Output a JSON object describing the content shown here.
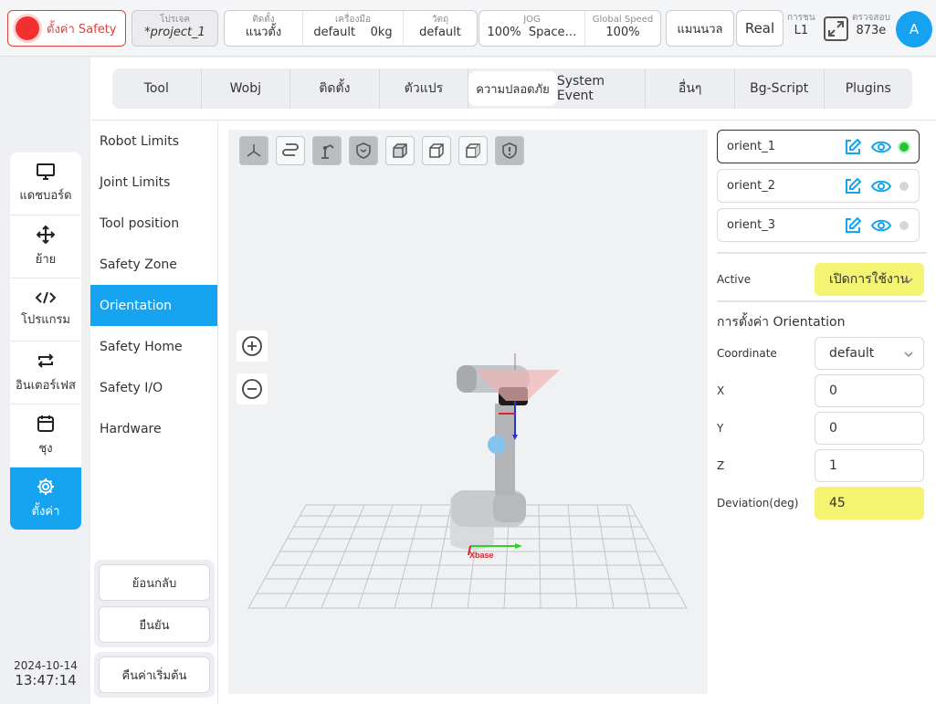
{
  "topbar": {
    "safety_label": "ตั้งค่า Safety",
    "project_label": "โปรเจค",
    "project_value": "*project_1",
    "install_label": "ติดตั้ง",
    "install_value": "แนวตั้ง",
    "tool_label": "เครื่องมือ",
    "tool_value": "default",
    "tool_weight": "0kg",
    "object_label": "วัตถุ",
    "object_value": "default",
    "jog_label": "JOG",
    "jog_value": "100%",
    "jog_space": "Space…",
    "speed_label": "Global Speed",
    "speed_value": "100%",
    "mode_button": "แมนนวล",
    "real_button": "Real",
    "layer_label": "การชน",
    "layer_value": "L1",
    "check_label": "ตรวจสอบ",
    "check_value": "873e",
    "avatar": "A"
  },
  "leftnav": [
    {
      "label": "แดชบอร์ด",
      "icon": "monitor-icon"
    },
    {
      "label": "ย้าย",
      "icon": "move-icon"
    },
    {
      "label": "โปรแกรม",
      "icon": "code-icon"
    },
    {
      "label": "อินเตอร์เฟส",
      "icon": "interface-icon"
    },
    {
      "label": "ชุง",
      "icon": "calendar-icon"
    },
    {
      "label": "ตั้งค่า",
      "icon": "gear-icon"
    }
  ],
  "datetime": {
    "date": "2024-10-14",
    "time": "13:47:14"
  },
  "tabs": [
    "Tool",
    "Wobj",
    "ติดตั้ง",
    "ตัวแปร",
    "ความปลอดภัย",
    "System Event",
    "อื่นๆ",
    "Bg-Script",
    "Plugins"
  ],
  "active_tab": "ความปลอดภัย",
  "subnav": [
    "Robot Limits",
    "Joint Limits",
    "Tool position",
    "Safety Zone",
    "Orientation",
    "Safety Home",
    "Safety I/O",
    "Hardware"
  ],
  "active_subnav": "Orientation",
  "buttons": {
    "back": "ย้อนกลับ",
    "confirm": "ยืนยัน",
    "reset": "คืนค่าเริ่มต้น"
  },
  "axis_label": "Xbase",
  "orients": [
    {
      "name": "orient_1",
      "active": true
    },
    {
      "name": "orient_2",
      "active": false
    },
    {
      "name": "orient_3",
      "active": false
    }
  ],
  "settings": {
    "active_label": "Active",
    "active_value": "เปิดการใช้งาน",
    "section_title": "การตั้งค่า Orientation",
    "coordinate_label": "Coordinate",
    "coordinate_value": "default",
    "x_label": "X",
    "x_value": "0",
    "y_label": "Y",
    "y_value": "0",
    "z_label": "Z",
    "z_value": "1",
    "deviation_label": "Deviation(deg)",
    "deviation_value": "45"
  },
  "colors": {
    "accent": "#16a3ef",
    "safety_red": "#e0403a",
    "highlight_yellow": "#f5f372",
    "active_green": "#22c534"
  }
}
